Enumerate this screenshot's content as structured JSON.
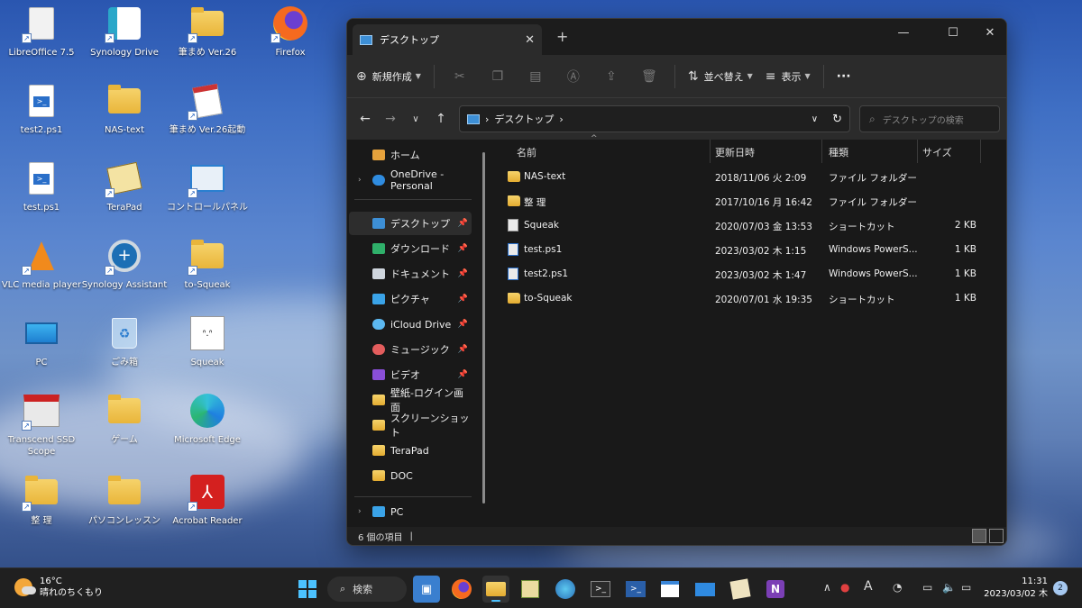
{
  "desktop": {
    "icons": [
      {
        "label": "LibreOffice 7.5"
      },
      {
        "label": "Synology Drive"
      },
      {
        "label": "筆まめ Ver.26"
      },
      {
        "label": "Firefox"
      },
      {
        "label": "test2.ps1"
      },
      {
        "label": "NAS-text"
      },
      {
        "label": "筆まめ Ver.26起動"
      },
      {
        "label": "test.ps1"
      },
      {
        "label": "TeraPad"
      },
      {
        "label": "コントロールパネル"
      },
      {
        "label": "VLC media player"
      },
      {
        "label": "Synology Assistant"
      },
      {
        "label": "to-Squeak"
      },
      {
        "label": "PC"
      },
      {
        "label": "ごみ箱"
      },
      {
        "label": "Squeak"
      },
      {
        "label": "Transcend SSD Scope"
      },
      {
        "label": "ゲーム"
      },
      {
        "label": "Microsoft Edge"
      },
      {
        "label": "整 理"
      },
      {
        "label": "パソコンレッスン"
      },
      {
        "label": "Acrobat Reader"
      }
    ]
  },
  "explorer": {
    "tab_title": "デスクトップ",
    "toolbar": {
      "new_label": "新規作成",
      "sort_label": "並べ替え",
      "view_label": "表示",
      "more_label": "···"
    },
    "address": {
      "path": "デスクトップ",
      "search_placeholder": "デスクトップの検索"
    },
    "nav": {
      "home": "ホーム",
      "onedrive": "OneDrive - Personal",
      "desktop": "デスクトップ",
      "downloads": "ダウンロード",
      "documents": "ドキュメント",
      "pictures": "ピクチャ",
      "icloud": "iCloud Drive",
      "music": "ミュージック",
      "videos": "ビデオ",
      "wallpaper": "壁紙-ログイン画面",
      "screenshots": "スクリーンショット",
      "terapad": "TeraPad",
      "doc": "DOC",
      "pc": "PC"
    },
    "columns": {
      "name": "名前",
      "modified": "更新日時",
      "type": "種類",
      "size": "サイズ"
    },
    "files": [
      {
        "name": "NAS-text",
        "modified": "2018/11/06 火 2:09",
        "type": "ファイル フォルダー",
        "size": ""
      },
      {
        "name": "整 理",
        "modified": "2017/10/16 月 16:42",
        "type": "ファイル フォルダー",
        "size": ""
      },
      {
        "name": "Squeak",
        "modified": "2020/07/03 金 13:53",
        "type": "ショートカット",
        "size": "2 KB"
      },
      {
        "name": "test.ps1",
        "modified": "2023/03/02 木 1:15",
        "type": "Windows PowerS...",
        "size": "1 KB"
      },
      {
        "name": "test2.ps1",
        "modified": "2023/03/02 木 1:47",
        "type": "Windows PowerS...",
        "size": "1 KB"
      },
      {
        "name": "to-Squeak",
        "modified": "2020/07/01 水 19:35",
        "type": "ショートカット",
        "size": "1 KB"
      }
    ],
    "status": "6 個の項目"
  },
  "taskbar": {
    "weather_temp": "16°C",
    "weather_desc": "晴れのちくもり",
    "search_label": "検索",
    "time": "11:31",
    "date": "2023/03/02 木",
    "notifications": "2",
    "ime_label": "A"
  },
  "colors": {
    "accent": "#3d8fd6",
    "folder": "#e9b53a",
    "window_bg": "#202020"
  }
}
